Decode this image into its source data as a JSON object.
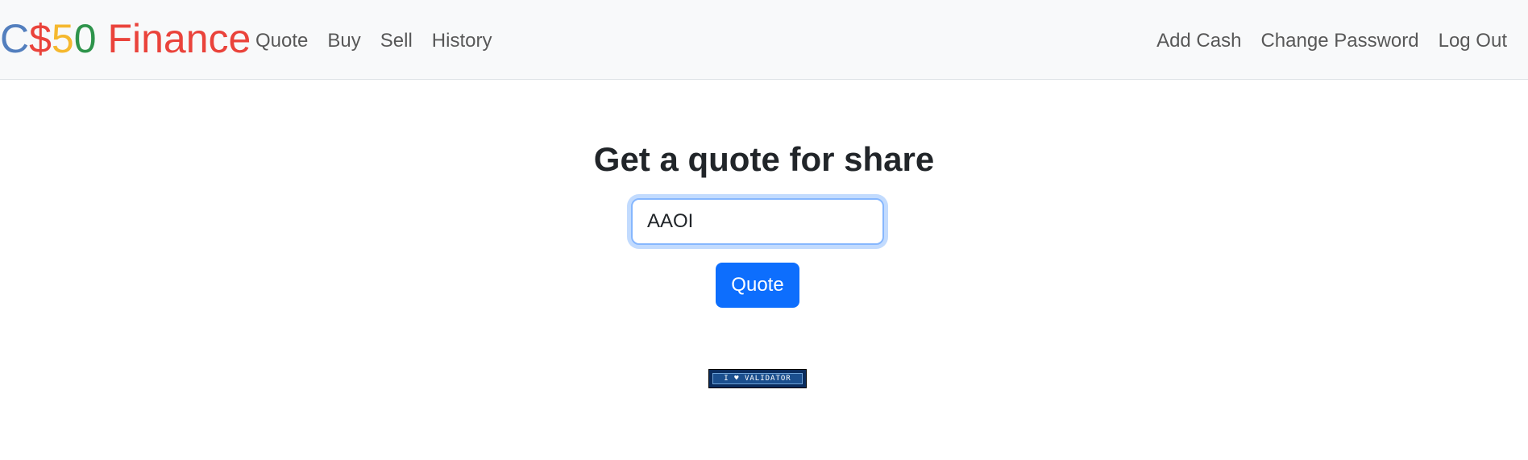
{
  "brand": {
    "c": "C",
    "dollar": "$",
    "five": "5",
    "zero": "0",
    "finance": " Finance"
  },
  "nav_left": [
    "Quote",
    "Buy",
    "Sell",
    "History"
  ],
  "nav_right": [
    "Add Cash",
    "Change Password",
    "Log Out"
  ],
  "main": {
    "title": "Get a quote for share",
    "input_value": "AAOI",
    "button_label": "Quote"
  },
  "footer": {
    "validator_text": "I ♥ VALIDATOR"
  },
  "colors": {
    "brand_blue": "#537fbe",
    "brand_red": "#ea433b",
    "brand_yellow": "#f5b82e",
    "brand_green": "#2e944b",
    "primary": "#0d6efd"
  }
}
